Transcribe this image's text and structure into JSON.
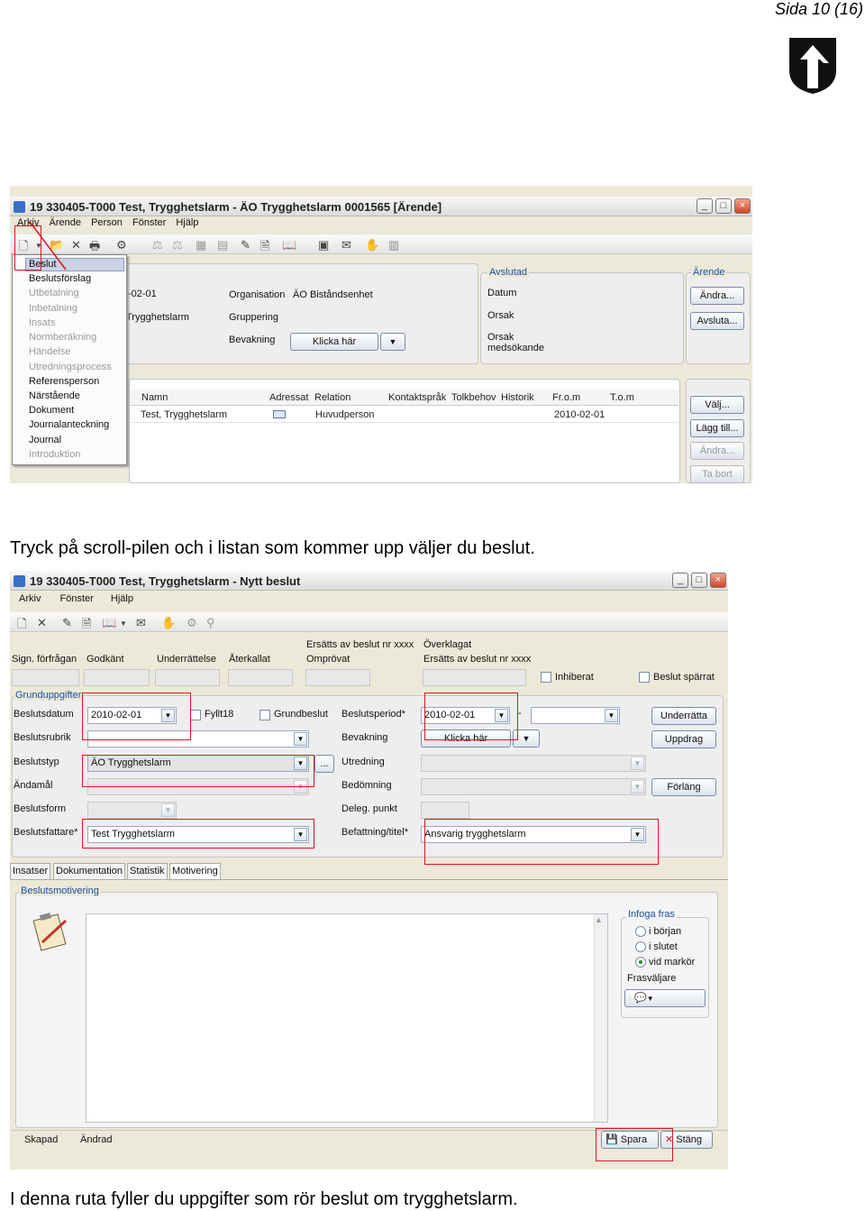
{
  "page": {
    "number": "Sida 10 (16)",
    "caption_1": "Tryck på scroll-pilen och i listan som kommer upp väljer du beslut.",
    "caption_2": "I denna ruta fyller du uppgifter som rör beslut om trygghetslarm."
  },
  "shot1": {
    "title": "19 330405-T000   Test, Trygghetslarm  -  ÄO Trygghetslarm   0001565  [Ärende]",
    "menu": [
      "Arkiv",
      "Ärende",
      "Person",
      "Fönster",
      "Hjälp"
    ],
    "dropdown": [
      {
        "label": "Beslut",
        "enabled": true,
        "selected": true
      },
      {
        "label": "Beslutsförslag",
        "enabled": true
      },
      {
        "label": "Utbetalning",
        "enabled": false
      },
      {
        "label": "Inbetalning",
        "enabled": false
      },
      {
        "label": "Insats",
        "enabled": false
      },
      {
        "label": "Normberäkning",
        "enabled": false
      },
      {
        "label": "Händelse",
        "enabled": false
      },
      {
        "label": "Utredningsprocess",
        "enabled": false
      },
      {
        "label": "Referensperson",
        "enabled": true
      },
      {
        "label": "Närstående",
        "enabled": true
      },
      {
        "label": "Dokument",
        "enabled": true
      },
      {
        "label": "Journalanteckning",
        "enabled": true
      },
      {
        "label": "Journal",
        "enabled": true
      },
      {
        "label": "Introduktion",
        "enabled": false
      }
    ],
    "info": {
      "date_partial": "-02-01",
      "name_partial": "Trygghetslarm",
      "organisation_label": "Organisation",
      "organisation_value": "ÄO Biståndsenhet",
      "gruppering_label": "Gruppering",
      "bevakning_label": "Bevakning",
      "klicka_har": "Klicka här"
    },
    "avslutad": {
      "group": "Avslutad",
      "datum": "Datum",
      "orsak": "Orsak",
      "orsak_med": "Orsak\nmedsökande"
    },
    "arende": {
      "group": "Ärende",
      "andra": "Ändra...",
      "avsluta": "Avsluta..."
    },
    "table": {
      "headers": [
        "Namn",
        "Adressat",
        "Relation",
        "Kontaktspråk",
        "Tolkbehov",
        "Historik",
        "Fr.o.m",
        "T.o.m"
      ],
      "row": {
        "namn": "Test, Trygghetslarm",
        "relation": "Huvudperson",
        "from": "2010-02-01"
      }
    },
    "side_buttons": [
      {
        "label": "Välj...",
        "enabled": true
      },
      {
        "label": "Lägg till...",
        "enabled": true
      },
      {
        "label": "Ändra...",
        "enabled": false
      },
      {
        "label": "Ta bort",
        "enabled": false
      }
    ]
  },
  "shot2": {
    "title": "19 330405-T000   Test, Trygghetslarm  -  Nytt beslut",
    "menu": [
      "Arkiv",
      "Fönster",
      "Hjälp"
    ],
    "header_labels": {
      "sign": "Sign. förfrågan",
      "godkant": "Godkänt",
      "underrattelse": "Underrättelse",
      "aterkallat": "Återkallat",
      "ersatts_av": "Ersätts av beslut nr xxxx",
      "omprovat": "Omprövat",
      "overklagat": "Överklagat",
      "ersatts_av2": "Ersätts av beslut nr xxxx",
      "inhiberat": "Inhiberat",
      "beslut_sparrat": "Beslut spärrat"
    },
    "grund": {
      "group": "Grunduppgifter",
      "beslutsdatum_label": "Beslutsdatum",
      "beslutsdatum": "2010-02-01",
      "fyllt18": "Fyllt18",
      "grundbeslut": "Grundbeslut",
      "beslutsperiod_label": "Beslutsperiod*",
      "beslutsperiod": "2010-02-01",
      "dash": "-",
      "beslutsrubrik_label": "Beslutsrubrik",
      "bevakning_label": "Bevakning",
      "klicka_har": "Klicka här",
      "beslutstyp_label": "Beslutstyp",
      "beslutstyp": "ÄO Trygghetslarm",
      "ellipsis": "...",
      "utredning_label": "Utredning",
      "andamal_label": "Ändamål",
      "bedomning_label": "Bedömning",
      "beslutsform_label": "Beslutsform",
      "deleg_label": "Deleg. punkt",
      "beslutsfattare_label": "Beslutsfattare*",
      "beslutsfattare": "Test Trygghetslarm",
      "befattning_label": "Befattning/titel*",
      "befattning": "Ansvarig trygghetslarm",
      "underratta": "Underrätta",
      "uppdrag": "Uppdrag",
      "forlang": "Förläng"
    },
    "tabs": [
      "Insatser",
      "Dokumentation",
      "Statistik",
      "Motivering"
    ],
    "motivering": {
      "group": "Beslutsmotivering",
      "infoga": "Infoga fras",
      "radios": [
        {
          "label": "i början",
          "selected": false
        },
        {
          "label": "i slutet",
          "selected": false
        },
        {
          "label": "vid markör",
          "selected": true
        }
      ],
      "frasvaljare": "Frasväljare"
    },
    "status": {
      "skapad": "Skapad",
      "andrad": "Ändrad",
      "spara": "Spara",
      "stang": "Stäng"
    }
  },
  "colors": {
    "accent_red": "#e0141e",
    "group_blue": "#1a4fa0",
    "window_bg": "#ece9d8"
  },
  "icons": [
    "municipal-shield-logo",
    "new-document-icon",
    "folder-open-icon",
    "delete-icon",
    "print-icon",
    "envelope-icon",
    "save-icon",
    "close-icon"
  ]
}
